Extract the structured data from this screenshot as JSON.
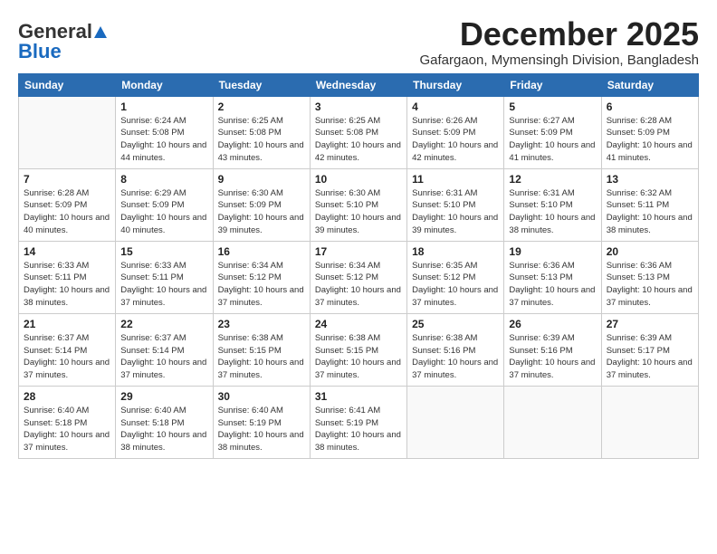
{
  "header": {
    "logo_general": "General",
    "logo_blue": "Blue",
    "month_title": "December 2025",
    "location": "Gafargaon, Mymensingh Division, Bangladesh"
  },
  "weekdays": [
    "Sunday",
    "Monday",
    "Tuesday",
    "Wednesday",
    "Thursday",
    "Friday",
    "Saturday"
  ],
  "weeks": [
    [
      {
        "day": "",
        "sunrise": "",
        "sunset": "",
        "daylight": ""
      },
      {
        "day": "1",
        "sunrise": "Sunrise: 6:24 AM",
        "sunset": "Sunset: 5:08 PM",
        "daylight": "Daylight: 10 hours and 44 minutes."
      },
      {
        "day": "2",
        "sunrise": "Sunrise: 6:25 AM",
        "sunset": "Sunset: 5:08 PM",
        "daylight": "Daylight: 10 hours and 43 minutes."
      },
      {
        "day": "3",
        "sunrise": "Sunrise: 6:25 AM",
        "sunset": "Sunset: 5:08 PM",
        "daylight": "Daylight: 10 hours and 42 minutes."
      },
      {
        "day": "4",
        "sunrise": "Sunrise: 6:26 AM",
        "sunset": "Sunset: 5:09 PM",
        "daylight": "Daylight: 10 hours and 42 minutes."
      },
      {
        "day": "5",
        "sunrise": "Sunrise: 6:27 AM",
        "sunset": "Sunset: 5:09 PM",
        "daylight": "Daylight: 10 hours and 41 minutes."
      },
      {
        "day": "6",
        "sunrise": "Sunrise: 6:28 AM",
        "sunset": "Sunset: 5:09 PM",
        "daylight": "Daylight: 10 hours and 41 minutes."
      }
    ],
    [
      {
        "day": "7",
        "sunrise": "Sunrise: 6:28 AM",
        "sunset": "Sunset: 5:09 PM",
        "daylight": "Daylight: 10 hours and 40 minutes."
      },
      {
        "day": "8",
        "sunrise": "Sunrise: 6:29 AM",
        "sunset": "Sunset: 5:09 PM",
        "daylight": "Daylight: 10 hours and 40 minutes."
      },
      {
        "day": "9",
        "sunrise": "Sunrise: 6:30 AM",
        "sunset": "Sunset: 5:09 PM",
        "daylight": "Daylight: 10 hours and 39 minutes."
      },
      {
        "day": "10",
        "sunrise": "Sunrise: 6:30 AM",
        "sunset": "Sunset: 5:10 PM",
        "daylight": "Daylight: 10 hours and 39 minutes."
      },
      {
        "day": "11",
        "sunrise": "Sunrise: 6:31 AM",
        "sunset": "Sunset: 5:10 PM",
        "daylight": "Daylight: 10 hours and 39 minutes."
      },
      {
        "day": "12",
        "sunrise": "Sunrise: 6:31 AM",
        "sunset": "Sunset: 5:10 PM",
        "daylight": "Daylight: 10 hours and 38 minutes."
      },
      {
        "day": "13",
        "sunrise": "Sunrise: 6:32 AM",
        "sunset": "Sunset: 5:11 PM",
        "daylight": "Daylight: 10 hours and 38 minutes."
      }
    ],
    [
      {
        "day": "14",
        "sunrise": "Sunrise: 6:33 AM",
        "sunset": "Sunset: 5:11 PM",
        "daylight": "Daylight: 10 hours and 38 minutes."
      },
      {
        "day": "15",
        "sunrise": "Sunrise: 6:33 AM",
        "sunset": "Sunset: 5:11 PM",
        "daylight": "Daylight: 10 hours and 37 minutes."
      },
      {
        "day": "16",
        "sunrise": "Sunrise: 6:34 AM",
        "sunset": "Sunset: 5:12 PM",
        "daylight": "Daylight: 10 hours and 37 minutes."
      },
      {
        "day": "17",
        "sunrise": "Sunrise: 6:34 AM",
        "sunset": "Sunset: 5:12 PM",
        "daylight": "Daylight: 10 hours and 37 minutes."
      },
      {
        "day": "18",
        "sunrise": "Sunrise: 6:35 AM",
        "sunset": "Sunset: 5:12 PM",
        "daylight": "Daylight: 10 hours and 37 minutes."
      },
      {
        "day": "19",
        "sunrise": "Sunrise: 6:36 AM",
        "sunset": "Sunset: 5:13 PM",
        "daylight": "Daylight: 10 hours and 37 minutes."
      },
      {
        "day": "20",
        "sunrise": "Sunrise: 6:36 AM",
        "sunset": "Sunset: 5:13 PM",
        "daylight": "Daylight: 10 hours and 37 minutes."
      }
    ],
    [
      {
        "day": "21",
        "sunrise": "Sunrise: 6:37 AM",
        "sunset": "Sunset: 5:14 PM",
        "daylight": "Daylight: 10 hours and 37 minutes."
      },
      {
        "day": "22",
        "sunrise": "Sunrise: 6:37 AM",
        "sunset": "Sunset: 5:14 PM",
        "daylight": "Daylight: 10 hours and 37 minutes."
      },
      {
        "day": "23",
        "sunrise": "Sunrise: 6:38 AM",
        "sunset": "Sunset: 5:15 PM",
        "daylight": "Daylight: 10 hours and 37 minutes."
      },
      {
        "day": "24",
        "sunrise": "Sunrise: 6:38 AM",
        "sunset": "Sunset: 5:15 PM",
        "daylight": "Daylight: 10 hours and 37 minutes."
      },
      {
        "day": "25",
        "sunrise": "Sunrise: 6:38 AM",
        "sunset": "Sunset: 5:16 PM",
        "daylight": "Daylight: 10 hours and 37 minutes."
      },
      {
        "day": "26",
        "sunrise": "Sunrise: 6:39 AM",
        "sunset": "Sunset: 5:16 PM",
        "daylight": "Daylight: 10 hours and 37 minutes."
      },
      {
        "day": "27",
        "sunrise": "Sunrise: 6:39 AM",
        "sunset": "Sunset: 5:17 PM",
        "daylight": "Daylight: 10 hours and 37 minutes."
      }
    ],
    [
      {
        "day": "28",
        "sunrise": "Sunrise: 6:40 AM",
        "sunset": "Sunset: 5:18 PM",
        "daylight": "Daylight: 10 hours and 37 minutes."
      },
      {
        "day": "29",
        "sunrise": "Sunrise: 6:40 AM",
        "sunset": "Sunset: 5:18 PM",
        "daylight": "Daylight: 10 hours and 38 minutes."
      },
      {
        "day": "30",
        "sunrise": "Sunrise: 6:40 AM",
        "sunset": "Sunset: 5:19 PM",
        "daylight": "Daylight: 10 hours and 38 minutes."
      },
      {
        "day": "31",
        "sunrise": "Sunrise: 6:41 AM",
        "sunset": "Sunset: 5:19 PM",
        "daylight": "Daylight: 10 hours and 38 minutes."
      },
      {
        "day": "",
        "sunrise": "",
        "sunset": "",
        "daylight": ""
      },
      {
        "day": "",
        "sunrise": "",
        "sunset": "",
        "daylight": ""
      },
      {
        "day": "",
        "sunrise": "",
        "sunset": "",
        "daylight": ""
      }
    ]
  ]
}
